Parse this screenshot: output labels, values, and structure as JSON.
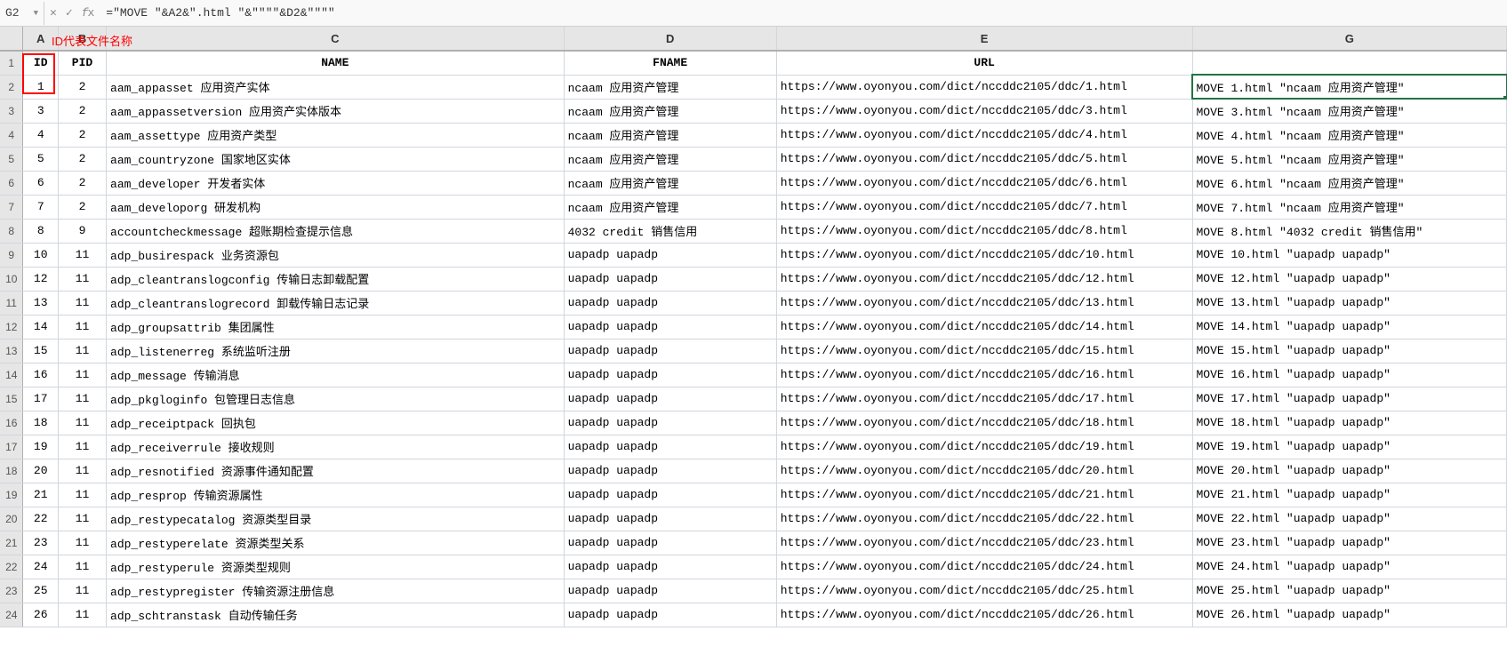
{
  "formula": {
    "cell_ref": "G2",
    "text": "=\"MOVE \"&A2&\".html \"&\"\"\"\"&D2&\"\"\"\""
  },
  "annotation": "ID代表文件名称",
  "cols": {
    "A": "A",
    "B": "B",
    "C": "C",
    "D": "D",
    "E": "E",
    "G": "G"
  },
  "row_numbers": [
    1,
    2,
    3,
    4,
    5,
    6,
    7,
    8,
    9,
    10,
    11,
    12,
    13,
    14,
    15,
    16,
    17,
    18,
    19,
    20,
    21,
    22,
    23,
    24
  ],
  "headers": {
    "id": "ID",
    "pid": "PID",
    "name": "NAME",
    "fname": "FNAME",
    "url": "URL"
  },
  "rows": [
    {
      "id": "1",
      "pid": "2",
      "name": "aam_appasset 应用资产实体",
      "fname": "ncaam 应用资产管理",
      "url": "https://www.oyonyou.com/dict/nccddc2105/ddc/1.html",
      "g": "MOVE 1.html \"ncaam 应用资产管理\""
    },
    {
      "id": "3",
      "pid": "2",
      "name": "aam_appassetversion 应用资产实体版本",
      "fname": "ncaam 应用资产管理",
      "url": "https://www.oyonyou.com/dict/nccddc2105/ddc/3.html",
      "g": "MOVE 3.html \"ncaam 应用资产管理\""
    },
    {
      "id": "4",
      "pid": "2",
      "name": "aam_assettype 应用资产类型",
      "fname": "ncaam 应用资产管理",
      "url": "https://www.oyonyou.com/dict/nccddc2105/ddc/4.html",
      "g": "MOVE 4.html \"ncaam 应用资产管理\""
    },
    {
      "id": "5",
      "pid": "2",
      "name": "aam_countryzone 国家地区实体",
      "fname": "ncaam 应用资产管理",
      "url": "https://www.oyonyou.com/dict/nccddc2105/ddc/5.html",
      "g": "MOVE 5.html \"ncaam 应用资产管理\""
    },
    {
      "id": "6",
      "pid": "2",
      "name": "aam_developer 开发者实体",
      "fname": "ncaam 应用资产管理",
      "url": "https://www.oyonyou.com/dict/nccddc2105/ddc/6.html",
      "g": "MOVE 6.html \"ncaam 应用资产管理\""
    },
    {
      "id": "7",
      "pid": "2",
      "name": "aam_developorg 研发机构",
      "fname": "ncaam 应用资产管理",
      "url": "https://www.oyonyou.com/dict/nccddc2105/ddc/7.html",
      "g": "MOVE 7.html \"ncaam 应用资产管理\""
    },
    {
      "id": "8",
      "pid": "9",
      "name": "accountcheckmessage 超账期检查提示信息",
      "fname": "4032 credit 销售信用",
      "url": "https://www.oyonyou.com/dict/nccddc2105/ddc/8.html",
      "g": "MOVE 8.html \"4032 credit 销售信用\""
    },
    {
      "id": "10",
      "pid": "11",
      "name": "adp_busirespack 业务资源包",
      "fname": "uapadp uapadp",
      "url": "https://www.oyonyou.com/dict/nccddc2105/ddc/10.html",
      "g": "MOVE 10.html \"uapadp uapadp\""
    },
    {
      "id": "12",
      "pid": "11",
      "name": "adp_cleantranslogconfig 传输日志卸载配置",
      "fname": "uapadp uapadp",
      "url": "https://www.oyonyou.com/dict/nccddc2105/ddc/12.html",
      "g": "MOVE 12.html \"uapadp uapadp\""
    },
    {
      "id": "13",
      "pid": "11",
      "name": "adp_cleantranslogrecord 卸载传输日志记录",
      "fname": "uapadp uapadp",
      "url": "https://www.oyonyou.com/dict/nccddc2105/ddc/13.html",
      "g": "MOVE 13.html \"uapadp uapadp\""
    },
    {
      "id": "14",
      "pid": "11",
      "name": "adp_groupsattrib 集团属性",
      "fname": "uapadp uapadp",
      "url": "https://www.oyonyou.com/dict/nccddc2105/ddc/14.html",
      "g": "MOVE 14.html \"uapadp uapadp\""
    },
    {
      "id": "15",
      "pid": "11",
      "name": "adp_listenerreg 系统监听注册",
      "fname": "uapadp uapadp",
      "url": "https://www.oyonyou.com/dict/nccddc2105/ddc/15.html",
      "g": "MOVE 15.html \"uapadp uapadp\""
    },
    {
      "id": "16",
      "pid": "11",
      "name": "adp_message 传输消息",
      "fname": "uapadp uapadp",
      "url": "https://www.oyonyou.com/dict/nccddc2105/ddc/16.html",
      "g": "MOVE 16.html \"uapadp uapadp\""
    },
    {
      "id": "17",
      "pid": "11",
      "name": "adp_pkgloginfo 包管理日志信息",
      "fname": "uapadp uapadp",
      "url": "https://www.oyonyou.com/dict/nccddc2105/ddc/17.html",
      "g": "MOVE 17.html \"uapadp uapadp\""
    },
    {
      "id": "18",
      "pid": "11",
      "name": "adp_receiptpack 回执包",
      "fname": "uapadp uapadp",
      "url": "https://www.oyonyou.com/dict/nccddc2105/ddc/18.html",
      "g": "MOVE 18.html \"uapadp uapadp\""
    },
    {
      "id": "19",
      "pid": "11",
      "name": "adp_receiverrule 接收规则",
      "fname": "uapadp uapadp",
      "url": "https://www.oyonyou.com/dict/nccddc2105/ddc/19.html",
      "g": "MOVE 19.html \"uapadp uapadp\""
    },
    {
      "id": "20",
      "pid": "11",
      "name": "adp_resnotified 资源事件通知配置",
      "fname": "uapadp uapadp",
      "url": "https://www.oyonyou.com/dict/nccddc2105/ddc/20.html",
      "g": "MOVE 20.html \"uapadp uapadp\""
    },
    {
      "id": "21",
      "pid": "11",
      "name": "adp_resprop 传输资源属性",
      "fname": "uapadp uapadp",
      "url": "https://www.oyonyou.com/dict/nccddc2105/ddc/21.html",
      "g": "MOVE 21.html \"uapadp uapadp\""
    },
    {
      "id": "22",
      "pid": "11",
      "name": "adp_restypecatalog 资源类型目录",
      "fname": "uapadp uapadp",
      "url": "https://www.oyonyou.com/dict/nccddc2105/ddc/22.html",
      "g": "MOVE 22.html \"uapadp uapadp\""
    },
    {
      "id": "23",
      "pid": "11",
      "name": "adp_restyperelate 资源类型关系",
      "fname": "uapadp uapadp",
      "url": "https://www.oyonyou.com/dict/nccddc2105/ddc/23.html",
      "g": "MOVE 23.html \"uapadp uapadp\""
    },
    {
      "id": "24",
      "pid": "11",
      "name": "adp_restyperule 资源类型规则",
      "fname": "uapadp uapadp",
      "url": "https://www.oyonyou.com/dict/nccddc2105/ddc/24.html",
      "g": "MOVE 24.html \"uapadp uapadp\""
    },
    {
      "id": "25",
      "pid": "11",
      "name": "adp_restypregister 传输资源注册信息",
      "fname": "uapadp uapadp",
      "url": "https://www.oyonyou.com/dict/nccddc2105/ddc/25.html",
      "g": "MOVE 25.html \"uapadp uapadp\""
    },
    {
      "id": "26",
      "pid": "11",
      "name": "adp_schtranstask 自动传输任务",
      "fname": "uapadp uapadp",
      "url": "https://www.oyonyou.com/dict/nccddc2105/ddc/26.html",
      "g": "MOVE 26.html \"uapadp uapadp\""
    }
  ]
}
